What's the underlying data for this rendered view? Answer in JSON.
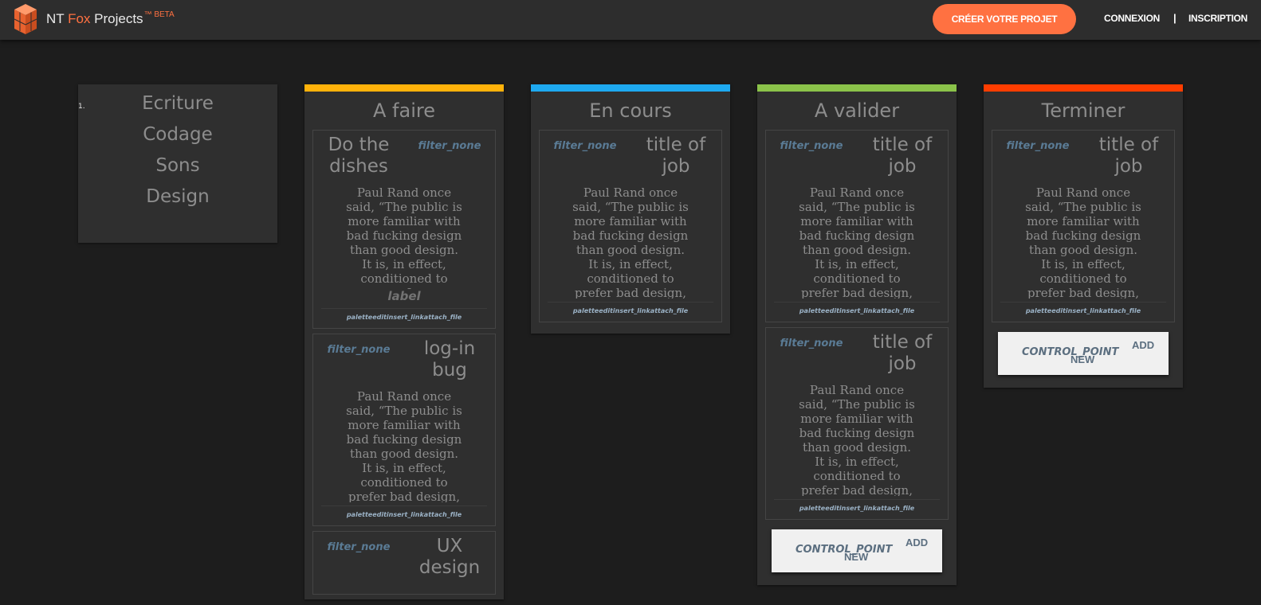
{
  "header": {
    "brand_nt": "NT ",
    "brand_fox": "Fox",
    "brand_projects": " Projects",
    "brand_tm": "™ BETA",
    "cta_label": "CRÉER VOTRE PROJET",
    "login_label": "CONNEXION",
    "separator": "|",
    "signup_label": "INSCRIPTION",
    "accent_color": "#ff7141"
  },
  "categories": {
    "number": "1.",
    "items": [
      "Ecriture",
      "Codage",
      "Sons",
      "Design"
    ]
  },
  "columns": [
    {
      "title": "A faire",
      "color": "#ffb20a",
      "cards": [
        {
          "icon": "filter_none",
          "title": "Do the dishes",
          "text": "Paul Rand once said, “The public is more familiar with bad fucking design than good design. It is, in effect, conditioned to prefer",
          "label": "label",
          "footer": "paletteeditinsert_linkattach_file"
        },
        {
          "icon": "filter_none",
          "title": "log-in bug",
          "text": "Paul Rand once said, “The public is more familiar with bad fucking design than good design. It is, in effect, conditioned to prefer bad design,",
          "footer": "paletteeditinsert_linkattach_file"
        },
        {
          "icon": "filter_none",
          "title": "UX design",
          "text": "",
          "footer": ""
        }
      ]
    },
    {
      "title": "En cours",
      "color": "#1ea9f0",
      "cards": [
        {
          "icon": "filter_none",
          "title": "title of job",
          "text": "Paul Rand once said, “The public is more familiar with bad fucking design than good design. It is, in effect, conditioned to prefer bad design,",
          "footer": "paletteeditinsert_linkattach_file"
        }
      ]
    },
    {
      "title": "A valider",
      "color": "#8bc34a",
      "cards": [
        {
          "icon": "filter_none",
          "title": "title of job",
          "text": "Paul Rand once said, “The public is more familiar with bad fucking design than good design. It is, in effect, conditioned to prefer bad design,",
          "footer": "paletteeditinsert_linkattach_file"
        },
        {
          "icon": "filter_none",
          "title": "title of job",
          "text": "Paul Rand once said, “The public is more familiar with bad fucking design than good design. It is, in effect, conditioned to prefer bad design,",
          "footer": "paletteeditinsert_linkattach_file"
        }
      ],
      "add_button": {
        "icon": "CONTROL_POINT",
        "add": "ADD",
        "new": "NEW"
      }
    },
    {
      "title": "Terminer",
      "color": "#ff3d00",
      "cards": [
        {
          "icon": "filter_none",
          "title": "title of job",
          "text": "Paul Rand once said, “The public is more familiar with bad fucking design than good design. It is, in effect, conditioned to prefer bad design,",
          "footer": "paletteeditinsert_linkattach_file"
        }
      ],
      "add_button": {
        "icon": "CONTROL_POINT",
        "add": "ADD",
        "new": "NEW"
      }
    }
  ]
}
